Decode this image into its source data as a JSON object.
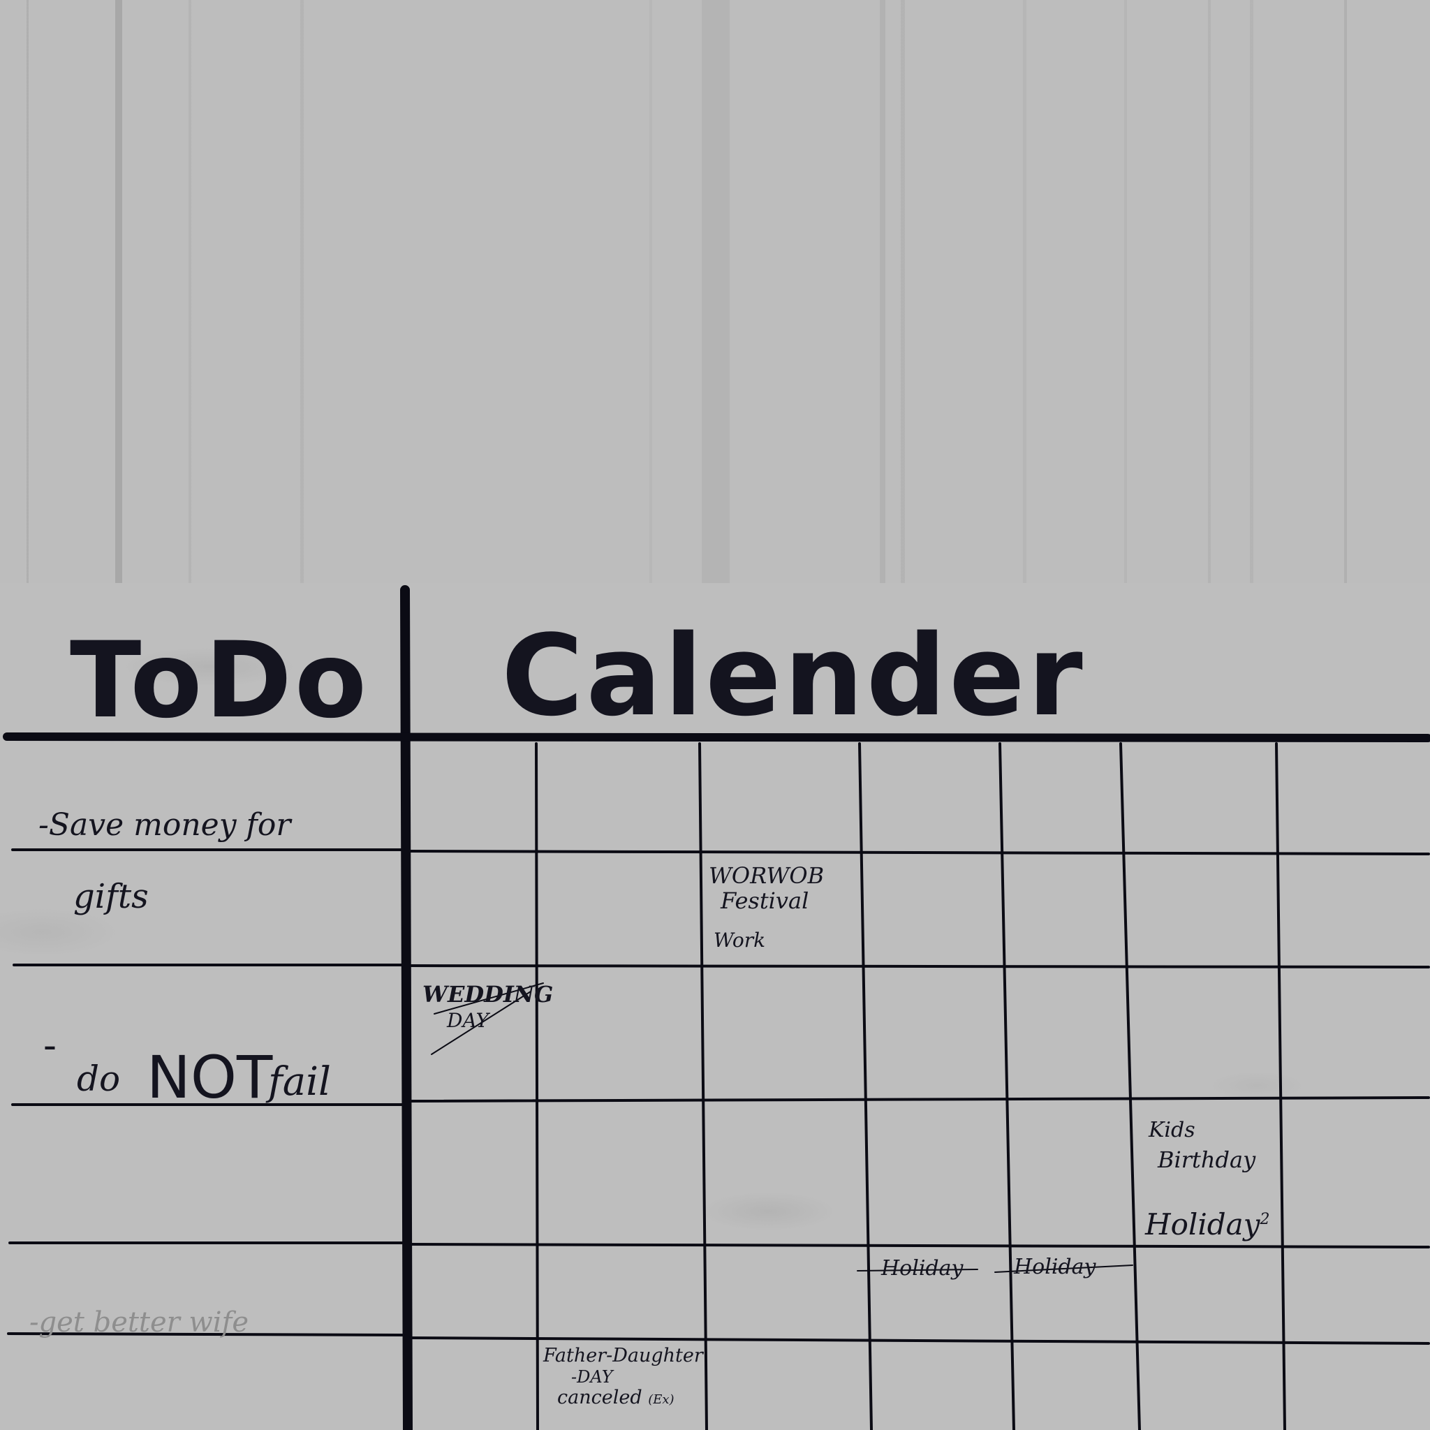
{
  "todo": {
    "title": "ToDo",
    "items": [
      {
        "text_1": "-Save money for",
        "text_2": "gifts"
      },
      {
        "dash": "-",
        "text_a": "do",
        "text_b": "NOT",
        "text_c": "fail"
      },
      {
        "text": "-get better wife"
      }
    ]
  },
  "calendar": {
    "title": "Calender",
    "entries": {
      "festival_1": "WORWOB",
      "festival_2": "Festival",
      "work": "Work",
      "wedding_1": "WEDDING",
      "wedding_2": "DAY",
      "kids_1": "Kids",
      "kids_2": "Birthday",
      "holiday_2": "Holiday",
      "holiday_2_sup": "2",
      "holiday_struck_1": "Holiday",
      "holiday_struck_2": "Holiday",
      "father_1": "Father-Daughter",
      "father_2": "-DAY",
      "father_3": "canceled",
      "father_3_suffix": "(Ex)"
    }
  },
  "colors": {
    "ink": "#14141f",
    "faded_ink": "#8e8e8e",
    "board": "#bebebe",
    "wall": "#bdbdbd"
  }
}
